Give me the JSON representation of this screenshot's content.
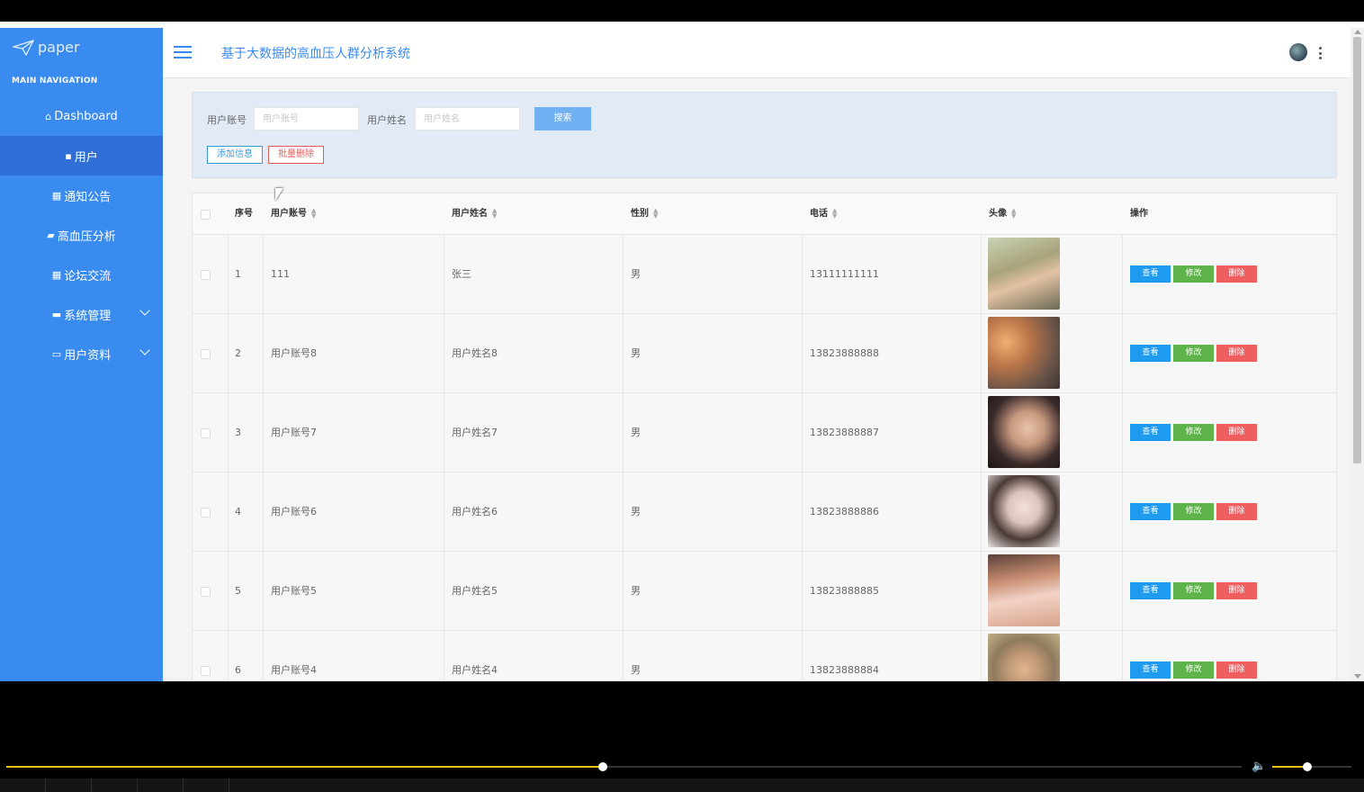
{
  "app": {
    "logo_text": "paper",
    "title": "基于大数据的高血压人群分析系统"
  },
  "sidebar": {
    "caption": "MAIN NAVIGATION",
    "items": [
      {
        "icon": "⌂",
        "label": "Dashboard"
      },
      {
        "icon": "▪",
        "label": "用户"
      },
      {
        "icon": "▦",
        "label": "通知公告"
      },
      {
        "icon": "▰",
        "label": "高血压分析"
      },
      {
        "icon": "▦",
        "label": "论坛交流"
      },
      {
        "icon": "▬",
        "label": "系统管理"
      },
      {
        "icon": "▭",
        "label": "用户资料"
      }
    ]
  },
  "search": {
    "account_label": "用户账号",
    "account_placeholder": "用户账号",
    "name_label": "用户姓名",
    "name_placeholder": "用户姓名",
    "search_button": "搜索",
    "add_button": "添加信息",
    "batch_delete_button": "批量删除"
  },
  "table": {
    "columns": [
      "序号",
      "用户账号",
      "用户姓名",
      "性别",
      "电话",
      "头像",
      "操作"
    ],
    "actions": {
      "view": "查看",
      "edit": "修改",
      "delete": "删除"
    },
    "rows": [
      {
        "index": "1",
        "account": "111",
        "name": "张三",
        "gender": "男",
        "phone": "13111111111"
      },
      {
        "index": "2",
        "account": "用户账号8",
        "name": "用户姓名8",
        "gender": "男",
        "phone": "13823888888"
      },
      {
        "index": "3",
        "account": "用户账号7",
        "name": "用户姓名7",
        "gender": "男",
        "phone": "13823888887"
      },
      {
        "index": "4",
        "account": "用户账号6",
        "name": "用户姓名6",
        "gender": "男",
        "phone": "13823888886"
      },
      {
        "index": "5",
        "account": "用户账号5",
        "name": "用户姓名5",
        "gender": "男",
        "phone": "13823888885"
      },
      {
        "index": "6",
        "account": "用户账号4",
        "name": "用户姓名4",
        "gender": "男",
        "phone": "13823888884"
      }
    ]
  },
  "player": {
    "progress": 0.483,
    "volume": 0.44
  },
  "colors": {
    "sidebar": "#3a8bf0",
    "accent": "#3a8bf0",
    "view": "#1e9af0",
    "edit": "#5fb34b",
    "delete": "#ef5f5f",
    "progress": "#e8c21a"
  }
}
